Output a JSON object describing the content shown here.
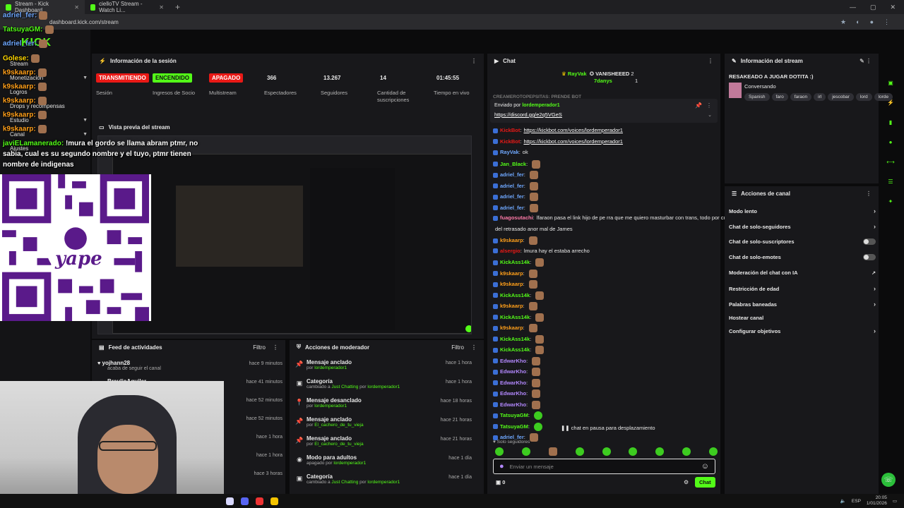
{
  "browser": {
    "tabs": [
      {
        "label": "Stream - Kick Dashboard",
        "active": true
      },
      {
        "label": "cielloTV Stream - Watch Li...",
        "active": false
      }
    ],
    "url": "dashboard.kick.com/stream"
  },
  "nav": {
    "logo": "KICK",
    "items": [
      "Stream",
      "Monetización",
      "Logros",
      "Drops y recompensas",
      "Estudio",
      "Canal",
      "Ajustes"
    ]
  },
  "session": {
    "title": "Información de la sesión",
    "stats": [
      {
        "value": "TRANSMITIENDO",
        "label": "Sesión",
        "style": "red"
      },
      {
        "value": "ENCENDIDO",
        "label": "Ingresos de Socio",
        "style": "green"
      },
      {
        "value": "APAGADO",
        "label": "Multistream",
        "style": "red"
      },
      {
        "value": "366",
        "label": "Espectadores",
        "style": "plain"
      },
      {
        "value": "13.267",
        "label": "Seguidores",
        "style": "plain"
      },
      {
        "value": "14",
        "label": "Cantidad de suscripciones",
        "style": "plain"
      },
      {
        "value": "01:45:55",
        "label": "Tiempo en vivo",
        "style": "plain"
      }
    ]
  },
  "preview": {
    "title": "Vista previa del stream"
  },
  "feed": {
    "title": "Feed de actividades",
    "filter": "Filtro",
    "rows": [
      {
        "name": "yojhann28",
        "sub": "acaba de seguir el canal",
        "time": "hace 9 minutos"
      },
      {
        "name": "BraulioAguilar",
        "sub": "",
        "time": "hace 41 minutos"
      },
      {
        "name": "",
        "sub": "",
        "time": "hace 52 minutos"
      },
      {
        "name": "",
        "sub": "",
        "time": "hace 52 minutos"
      },
      {
        "name": "",
        "sub": "",
        "time": "hace 1 hora"
      },
      {
        "name": "",
        "sub": "",
        "time": "hace 1 hora"
      },
      {
        "name": "",
        "sub": "",
        "time": "hace 3 horas"
      }
    ]
  },
  "mod": {
    "title": "Acciones de moderador",
    "filter": "Filtro",
    "rows": [
      {
        "icon": "pin",
        "title": "Mensaje anclado",
        "pre": "por",
        "who": "lordemperador1",
        "time": "hace 1 hora"
      },
      {
        "icon": "category",
        "title": "Categoría",
        "pre": "cambiado a",
        "who": "Just Chatting",
        "mid": "por",
        "who2": "lordemperador1",
        "time": "hace 1 hora"
      },
      {
        "icon": "unpin",
        "title": "Mensaje desanclado",
        "pre": "por",
        "who": "lordemperador1",
        "time": "hace 18 horas"
      },
      {
        "icon": "pin",
        "title": "Mensaje anclado",
        "pre": "por",
        "who": "El_cachero_de_tu_vieja",
        "time": "hace 21 horas"
      },
      {
        "icon": "pin",
        "title": "Mensaje anclado",
        "pre": "por",
        "who": "El_cachero_de_tu_vieja",
        "time": "hace 21 horas"
      },
      {
        "icon": "eye",
        "title": "Modo para adultos",
        "pre": "apagado por",
        "who": "lordemperador1",
        "time": "hace 1 día"
      },
      {
        "icon": "category",
        "title": "Categoría",
        "pre": "cambiado a",
        "who": "Just Chatting",
        "mid": "por",
        "who2": "lordemperador1",
        "time": "hace 1 día"
      }
    ]
  },
  "chat": {
    "title": "Chat",
    "leaders": [
      {
        "name": "RayVak",
        "rank": ""
      },
      {
        "name": "VANISHEEED",
        "rank": "2"
      },
      {
        "name": "7danys",
        "rank": "1"
      }
    ],
    "pinned_by": "Enviado por",
    "pinned_user": "lordemperador1",
    "pinned_link": "https://discord.gg/e2q5VGeS",
    "cut_line": "CREAMEROTOPEPSITAS: PRENDE BOT",
    "lines": [
      {
        "user": "KickBot",
        "color": "#e91916",
        "text": "https://kickbot.com/voices/lordemperador1",
        "link": true
      },
      {
        "user": "KickBot",
        "color": "#e91916",
        "text": "https://kickbot.com/voices/lordemperador1",
        "link": true
      },
      {
        "user": "RayVak",
        "color": "#6fa8ff",
        "text": "ok"
      },
      {
        "user": "Jan_Black",
        "color": "#53fc18",
        "text": "",
        "emote": 1
      },
      {
        "user": "adriel_fer",
        "color": "#6fa8ff",
        "text": "",
        "emote": 1
      },
      {
        "user": "adriel_fer",
        "color": "#6fa8ff",
        "text": "",
        "emote": 1
      },
      {
        "user": "adriel_fer",
        "color": "#6fa8ff",
        "text": "",
        "emote": 1
      },
      {
        "user": "adriel_fer",
        "color": "#6fa8ff",
        "text": "",
        "emote": 1
      },
      {
        "user": "fuagosutachi",
        "color": "#ff7aa8",
        "text": "lfaraon pasa el link hijo de pe rra que me quiero masturbar con trans, todo por culpa"
      },
      {
        "user": "",
        "color": "#ffffff",
        "text": "del retrasado anor mal de James"
      },
      {
        "user": "k9skaarp",
        "color": "#ff9f1a",
        "text": "",
        "emote": 1
      },
      {
        "user": "alsergio",
        "color": "#e91916",
        "text": "lmura hay el estaba arrecho"
      },
      {
        "user": "KickAss14k",
        "color": "#53fc18",
        "text": "",
        "emote": 1
      },
      {
        "user": "k9skaarp",
        "color": "#ff9f1a",
        "text": "",
        "emote": 1
      },
      {
        "user": "k9skaarp",
        "color": "#ff9f1a",
        "text": "",
        "emote": 1
      },
      {
        "user": "KickAss14k",
        "color": "#53fc18",
        "text": "",
        "emote": 1
      },
      {
        "user": "k9skaarp",
        "color": "#ff9f1a",
        "text": "",
        "emote": 1
      },
      {
        "user": "KickAss14k",
        "color": "#53fc18",
        "text": "",
        "emote": 1
      },
      {
        "user": "k9skaarp",
        "color": "#ff9f1a",
        "text": "",
        "emote": 1
      },
      {
        "user": "KickAss14k",
        "color": "#53fc18",
        "text": "",
        "emote": 1
      },
      {
        "user": "KickAss14k",
        "color": "#53fc18",
        "text": "",
        "emote": 1
      },
      {
        "user": "EdwarKho",
        "color": "#b388ff",
        "text": "",
        "emote": 1
      },
      {
        "user": "EdwarKho",
        "color": "#b388ff",
        "text": "",
        "emote": 1
      },
      {
        "user": "EdwarKho",
        "color": "#b388ff",
        "text": "",
        "emote": 1
      },
      {
        "user": "EdwarKho",
        "color": "#b388ff",
        "text": "",
        "emote": 1
      },
      {
        "user": "EdwarKho",
        "color": "#b388ff",
        "text": "",
        "emote": 1
      },
      {
        "user": "TatsuyaGM",
        "color": "#53fc18",
        "text": "",
        "emote": 2
      },
      {
        "user": "TatsuyaGM",
        "color": "#53fc18",
        "text": "",
        "emote": 2
      },
      {
        "user": "adriel_fer",
        "color": "#6fa8ff",
        "text": "",
        "emote": 1
      }
    ],
    "paused": "chat en pausa para desplazamiento",
    "followers_only": "Solo seguidores",
    "input_placeholder": "Enviar un mensaje",
    "count": "0",
    "send": "Chat"
  },
  "stream_info": {
    "title": "Información del stream",
    "stream_title": "RESAKEADO A JUGAR DOTITA :)",
    "category": "Conversando",
    "tags": [
      "Spanish",
      "faro",
      "faraon",
      "irl",
      "jescobar",
      "lord",
      "lorde"
    ]
  },
  "channel_actions": {
    "title": "Acciones de canal",
    "items": [
      {
        "label": "Modo lento",
        "control": "arrow"
      },
      {
        "label": "Chat de solo-seguidores",
        "control": "arrow"
      },
      {
        "label": "Chat de solo-suscriptores",
        "control": "toggle"
      },
      {
        "label": "Chat de solo-emotes",
        "control": "toggle"
      },
      {
        "label": "Moderación del chat con IA",
        "control": "ext"
      },
      {
        "label": "Restricción de edad",
        "control": "arrow"
      },
      {
        "label": "Palabras baneadas",
        "control": "arrow"
      },
      {
        "label": "Hostear canal",
        "control": "none"
      },
      {
        "label": "Configurar objetivos",
        "control": "arrow"
      }
    ]
  },
  "overlay": {
    "chat": [
      {
        "user": "adriel_fer",
        "color": "#6fa8ff"
      },
      {
        "user": "TatsuyaGM",
        "color": "#53fc18"
      },
      {
        "user": "adriel_fer",
        "color": "#6fa8ff"
      },
      {
        "user": "Golese",
        "color": "#ffd600"
      },
      {
        "user": "k9skaarp",
        "color": "#ff9f1a"
      },
      {
        "user": "k9skaarp",
        "color": "#ff9f1a"
      },
      {
        "user": "k9skaarp",
        "color": "#ff9f1a"
      },
      {
        "user": "k9skaarp",
        "color": "#ff9f1a"
      },
      {
        "user": "k9skaarp",
        "color": "#ff9f1a"
      }
    ],
    "big_user": "javiELamanerado:",
    "big_text": "!mura el gordo se llama abram ptmr, no sabia, cual es su segundo nombre y el tuyo, ptmr tienen nombre de indigenas",
    "qr_brand": "yape"
  },
  "taskbar": {
    "lang": "ESP",
    "time": "20:05",
    "date": "1/01/2026"
  }
}
